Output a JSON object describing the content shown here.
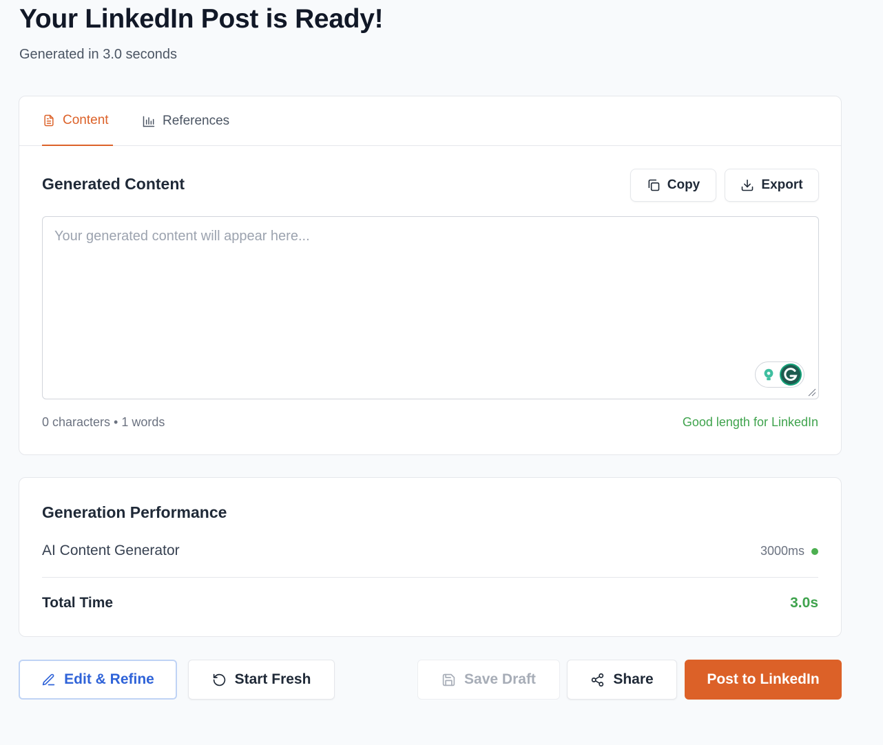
{
  "header": {
    "title": "Your LinkedIn Post is Ready!",
    "subtitle": "Generated in 3.0 seconds"
  },
  "tabs": [
    {
      "label": "Content",
      "icon": "document-icon",
      "active": true
    },
    {
      "label": "References",
      "icon": "bar-chart-icon",
      "active": false
    }
  ],
  "content": {
    "title": "Generated Content",
    "copy_label": "Copy",
    "export_label": "Export",
    "placeholder": "Your generated content will appear here...",
    "value": "",
    "stats": "0 characters • 1 words",
    "length_note": "Good length for LinkedIn"
  },
  "performance": {
    "title": "Generation Performance",
    "rows": [
      {
        "label": "AI Content Generator",
        "value": "3000ms",
        "status": "complete"
      }
    ],
    "total_label": "Total Time",
    "total_value": "3.0s"
  },
  "actions": {
    "edit_label": "Edit & Refine",
    "fresh_label": "Start Fresh",
    "draft_label": "Save Draft",
    "share_label": "Share",
    "post_label": "Post to LinkedIn"
  },
  "colors": {
    "accent": "#dc6128",
    "success": "#3fa34d",
    "link": "#2f63d8",
    "background": "#f8fafc"
  }
}
